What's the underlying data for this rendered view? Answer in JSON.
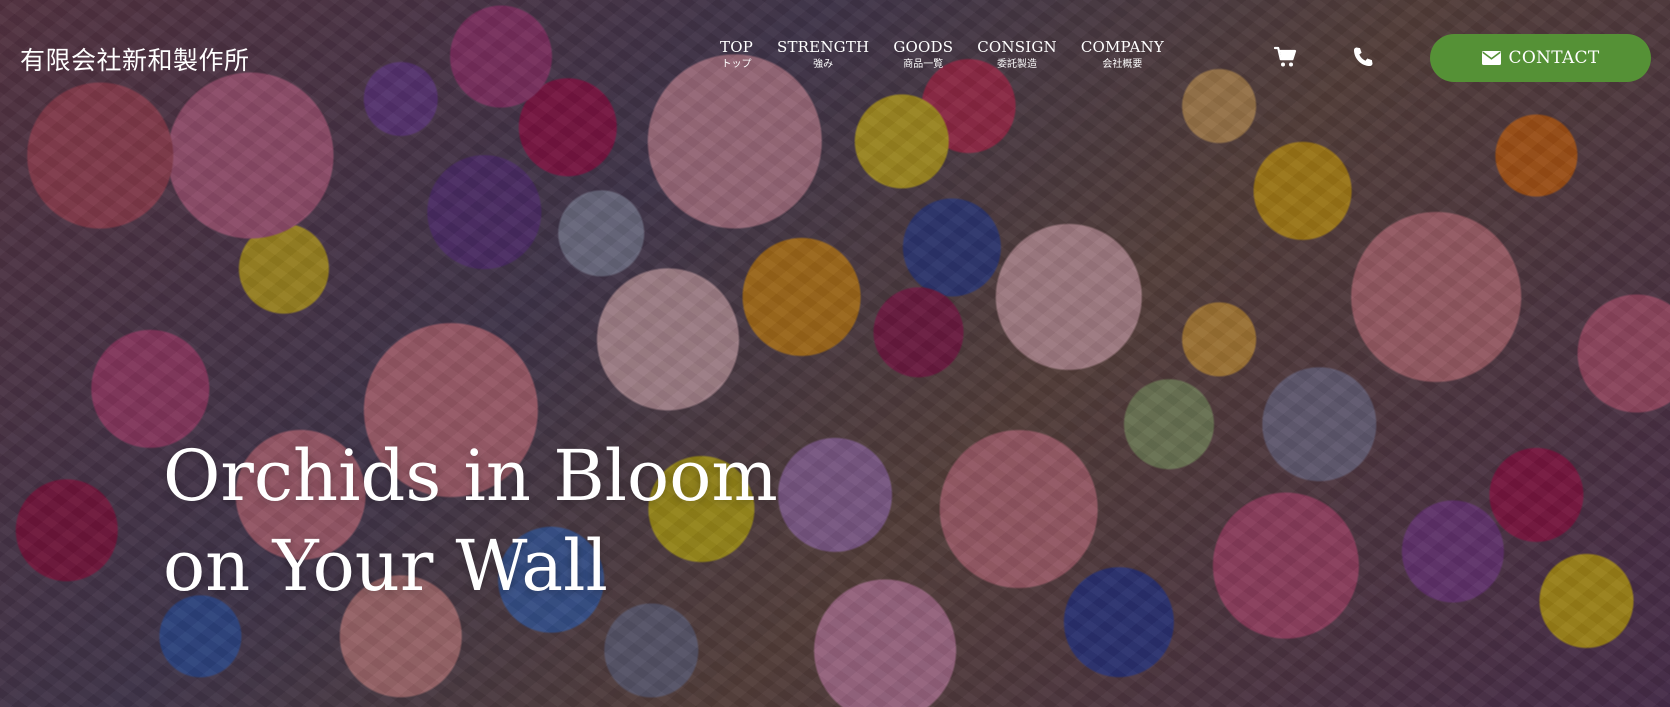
{
  "header": {
    "logo_text": "有限会社新和製作所"
  },
  "nav": {
    "items": [
      {
        "en": "TOP",
        "ja": "トップ"
      },
      {
        "en": "STRENGTH",
        "ja": "強み"
      },
      {
        "en": "GOODS",
        "ja": "商品一覧"
      },
      {
        "en": "CONSIGN",
        "ja": "委託製造"
      },
      {
        "en": "COMPANY",
        "ja": "会社概要"
      }
    ],
    "cart_icon": "cart-icon",
    "phone_icon": "phone-icon",
    "contact": {
      "label": "CONTACT",
      "icon": "envelope-icon",
      "color": "#559136"
    }
  },
  "hero": {
    "headline_line1": "Orchids in Bloom",
    "headline_line2": "on Your Wall",
    "background": "flower-wall-image"
  }
}
